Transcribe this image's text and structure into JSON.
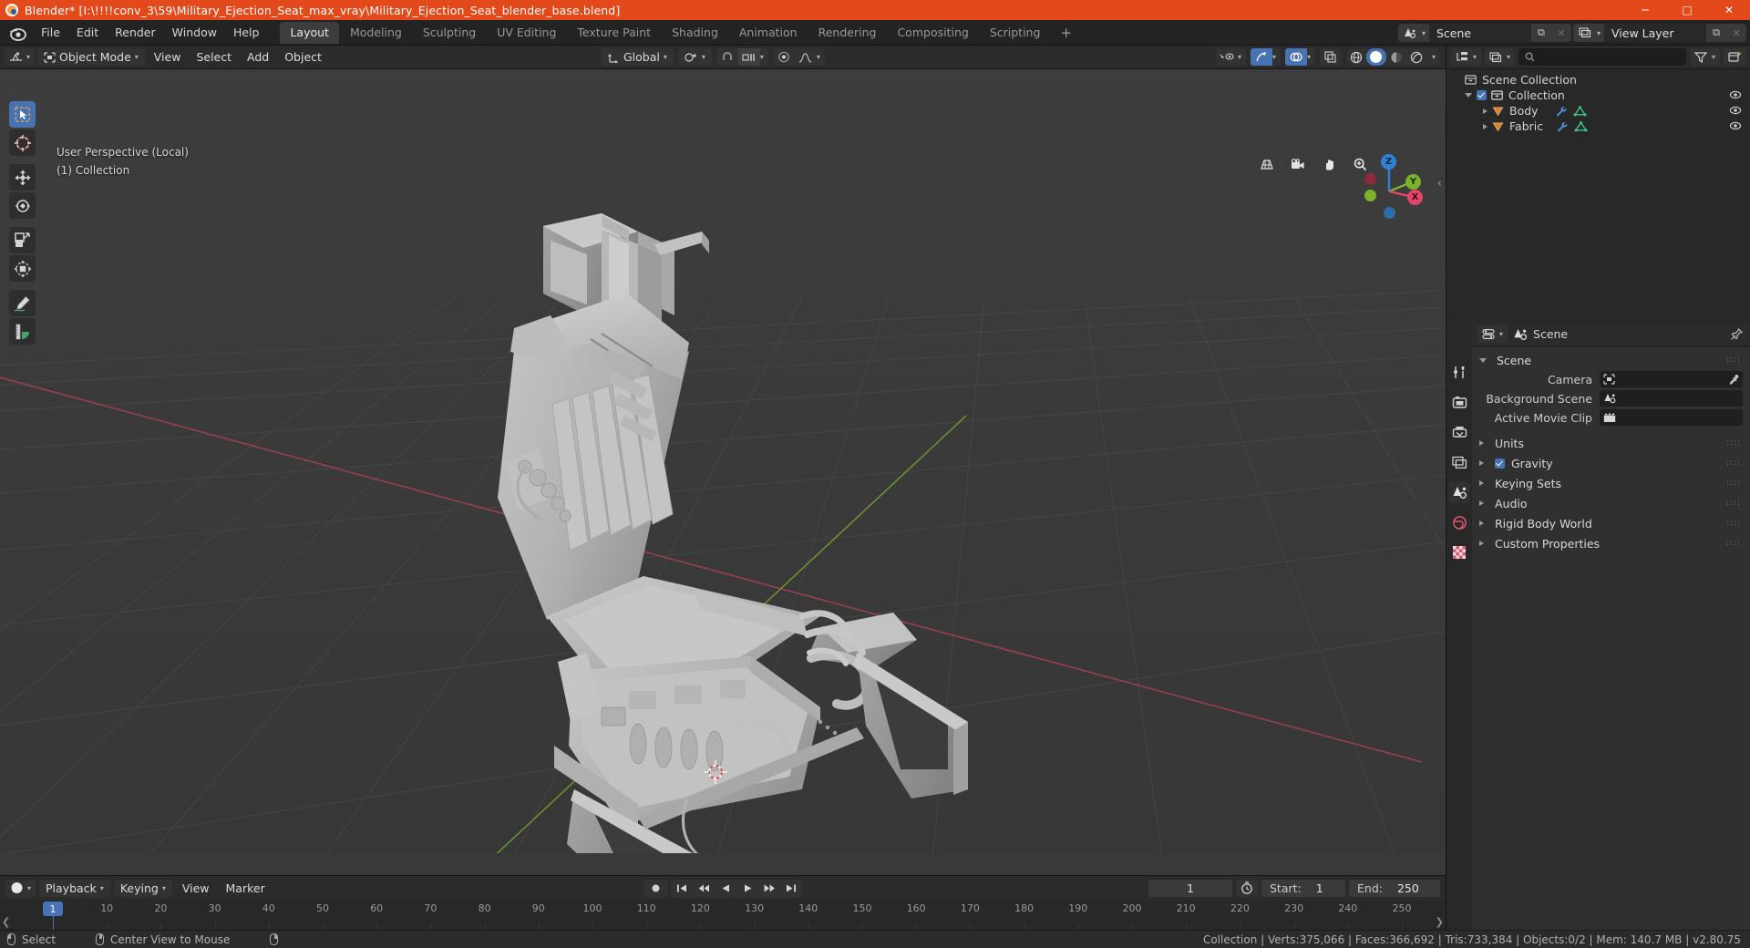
{
  "titlebar": {
    "app_icon": "blender-logo-icon",
    "title": "Blender* [I:\\!!!!conv_3\\59\\Military_Ejection_Seat_max_vray\\Military_Ejection_Seat_blender_base.blend]",
    "minimize": "─",
    "maximize": "□",
    "close": "✕"
  },
  "topbar": {
    "menus": [
      "File",
      "Edit",
      "Render",
      "Window",
      "Help"
    ],
    "workspaces": [
      {
        "label": "Layout",
        "active": true
      },
      {
        "label": "Modeling",
        "active": false
      },
      {
        "label": "Sculpting",
        "active": false
      },
      {
        "label": "UV Editing",
        "active": false
      },
      {
        "label": "Texture Paint",
        "active": false
      },
      {
        "label": "Shading",
        "active": false
      },
      {
        "label": "Animation",
        "active": false
      },
      {
        "label": "Rendering",
        "active": false
      },
      {
        "label": "Compositing",
        "active": false
      },
      {
        "label": "Scripting",
        "active": false
      }
    ],
    "add_workspace": "+",
    "scene": {
      "label": "Scene",
      "new_btn": "⧉",
      "unlink_btn": "✕"
    },
    "view_layer": {
      "label": "View Layer",
      "new_btn": "⧉",
      "unlink_btn": "✕"
    }
  },
  "viewport_header": {
    "editor_type_icon": "editor-type-3dview-icon",
    "mode": "Object Mode",
    "menus": [
      "View",
      "Select",
      "Add",
      "Object"
    ],
    "transform_orientation": "Global",
    "pivot_icon": "pivot-point-icon",
    "snap_icon": "magnet-icon",
    "snap_target": "snap-increment-icon",
    "proportional_icon": "proportional-editing-icon",
    "falloff_icon": "smooth-falloff-icon",
    "visibility_icon": "visibility-selectability-icon",
    "gizmo_icon": "gizmo-icon",
    "overlays_icon": "overlays-icon",
    "xray_icon": "xray-toggle-icon",
    "shading_modes": [
      "wireframe",
      "solid",
      "material",
      "rendered"
    ],
    "active_shading": "solid"
  },
  "viewport": {
    "perspective_text": "User Perspective (Local)",
    "collection_text": "(1) Collection",
    "tools": [
      {
        "name": "tweak-select-tool",
        "active": true
      },
      {
        "name": "cursor-tool",
        "active": false
      },
      {
        "name": "move-tool",
        "active": false
      },
      {
        "name": "rotate-tool",
        "active": false
      },
      {
        "name": "scale-tool",
        "active": false
      },
      {
        "name": "transform-tool",
        "active": false
      },
      {
        "name": "annotate-tool",
        "active": false
      },
      {
        "name": "measure-tool",
        "active": false
      }
    ],
    "nav_buttons": [
      "zoom-region-icon",
      "camera-view-icon",
      "pan-view-icon",
      "zoom-view-icon"
    ],
    "axis_labels": [
      "Z",
      "Y",
      "X"
    ],
    "axis_colors": {
      "x": "#e5446a",
      "y": "#7bb22a",
      "z": "#2d82d8"
    },
    "sidebar_toggle": "‹"
  },
  "timeline": {
    "editor_icon": "timeline-editor-icon",
    "menus": [
      "Playback",
      "Keying",
      "View",
      "Marker"
    ],
    "transport": [
      "jump-start-icon",
      "prev-keyframe-icon",
      "play-reverse-icon",
      "play-icon",
      "next-keyframe-icon",
      "jump-end-icon"
    ],
    "record_icon": "record-icon",
    "current_frame": "1",
    "auto_key_icon": "auto-keying-icon",
    "start_label": "Start:",
    "start_value": "1",
    "end_label": "End:",
    "end_value": "250",
    "ticks": [
      1,
      10,
      20,
      30,
      40,
      50,
      60,
      70,
      80,
      90,
      100,
      110,
      120,
      130,
      140,
      150,
      160,
      170,
      180,
      190,
      200,
      210,
      220,
      230,
      240,
      250
    ],
    "playhead_frame": "1"
  },
  "outliner": {
    "display_mode_icon": "outliner-display-mode-icon",
    "view_layer_icon": "view-layer-icon",
    "search_placeholder": "",
    "search_value": "",
    "filter_icon": "filter-icon",
    "new_collection_icon": "new-collection-icon",
    "rows": [
      {
        "label": "Scene Collection",
        "indent": 0,
        "icon": "collection-icon",
        "has_disclosure": false,
        "checkbox": false,
        "eye": false,
        "modifier": false
      },
      {
        "label": "Collection",
        "indent": 1,
        "icon": "collection-icon",
        "has_disclosure": true,
        "checkbox": true,
        "eye": true,
        "modifier": false
      },
      {
        "label": "Body",
        "indent": 2,
        "icon": "mesh-object-icon",
        "has_disclosure": true,
        "checkbox": false,
        "eye": true,
        "modifier": true
      },
      {
        "label": "Fabric",
        "indent": 2,
        "icon": "mesh-object-icon",
        "has_disclosure": true,
        "checkbox": false,
        "eye": true,
        "modifier": true
      }
    ]
  },
  "properties": {
    "editor_icon": "properties-editor-icon",
    "breadcrumb_icon": "scene-properties-icon",
    "breadcrumb": "Scene",
    "pin_icon": "pin-icon",
    "tabs": [
      {
        "name": "tool-properties-tab",
        "icon": "tool-icon",
        "active": false
      },
      {
        "name": "render-properties-tab",
        "icon": "camera-back-icon",
        "active": false
      },
      {
        "name": "output-properties-tab",
        "icon": "printer-icon",
        "active": false
      },
      {
        "name": "view-layer-properties-tab",
        "icon": "images-icon",
        "active": false
      },
      {
        "name": "scene-properties-tab",
        "icon": "scene-cone-icon",
        "active": true
      },
      {
        "name": "world-properties-tab",
        "icon": "world-icon",
        "active": false
      },
      {
        "name": "texture-properties-tab",
        "icon": "checker-icon",
        "active": false
      }
    ],
    "panel_title": "Scene",
    "fields": [
      {
        "label": "Camera",
        "icon": "camera-data-icon",
        "value": "",
        "eyedropper": true
      },
      {
        "label": "Background Scene",
        "icon": "scene-cone-icon",
        "value": "",
        "eyedropper": false
      },
      {
        "label": "Active Movie Clip",
        "icon": "movie-clip-icon",
        "value": "",
        "eyedropper": false
      }
    ],
    "sections": [
      {
        "label": "Units",
        "checkbox": false
      },
      {
        "label": "Gravity",
        "checkbox": true
      },
      {
        "label": "Keying Sets",
        "checkbox": false
      },
      {
        "label": "Audio",
        "checkbox": false
      },
      {
        "label": "Rigid Body World",
        "checkbox": false
      },
      {
        "label": "Custom Properties",
        "checkbox": false
      }
    ]
  },
  "statusbar": {
    "keymap": [
      {
        "mouse": "left",
        "label": "Select"
      },
      {
        "mouse": "middle",
        "label": "Center View to Mouse"
      },
      {
        "mouse": "right",
        "label": ""
      }
    ],
    "stats": "Collection | Verts:375,066 | Faces:366,692 | Tris:733,384 | Objects:0/2 | Mem: 140.7 MB | v2.80.75"
  }
}
